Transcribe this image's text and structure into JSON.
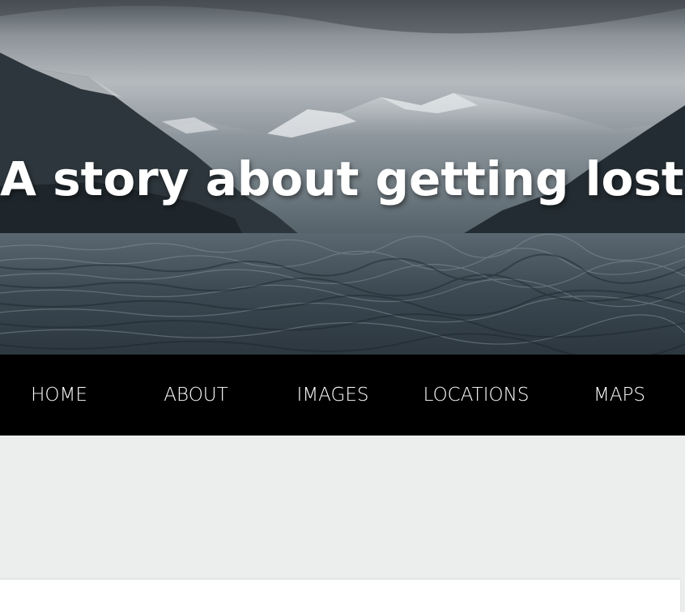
{
  "hero": {
    "title": "A story about getting lost."
  },
  "nav": {
    "items": [
      {
        "label": "HOME"
      },
      {
        "label": "ABOUT"
      },
      {
        "label": "IMAGES"
      },
      {
        "label": "LOCATIONS"
      },
      {
        "label": "MAPS"
      }
    ]
  },
  "colors": {
    "nav_background": "#000000",
    "nav_text": "#ffffff",
    "page_background": "#eceeed",
    "card_background": "#ffffff"
  }
}
